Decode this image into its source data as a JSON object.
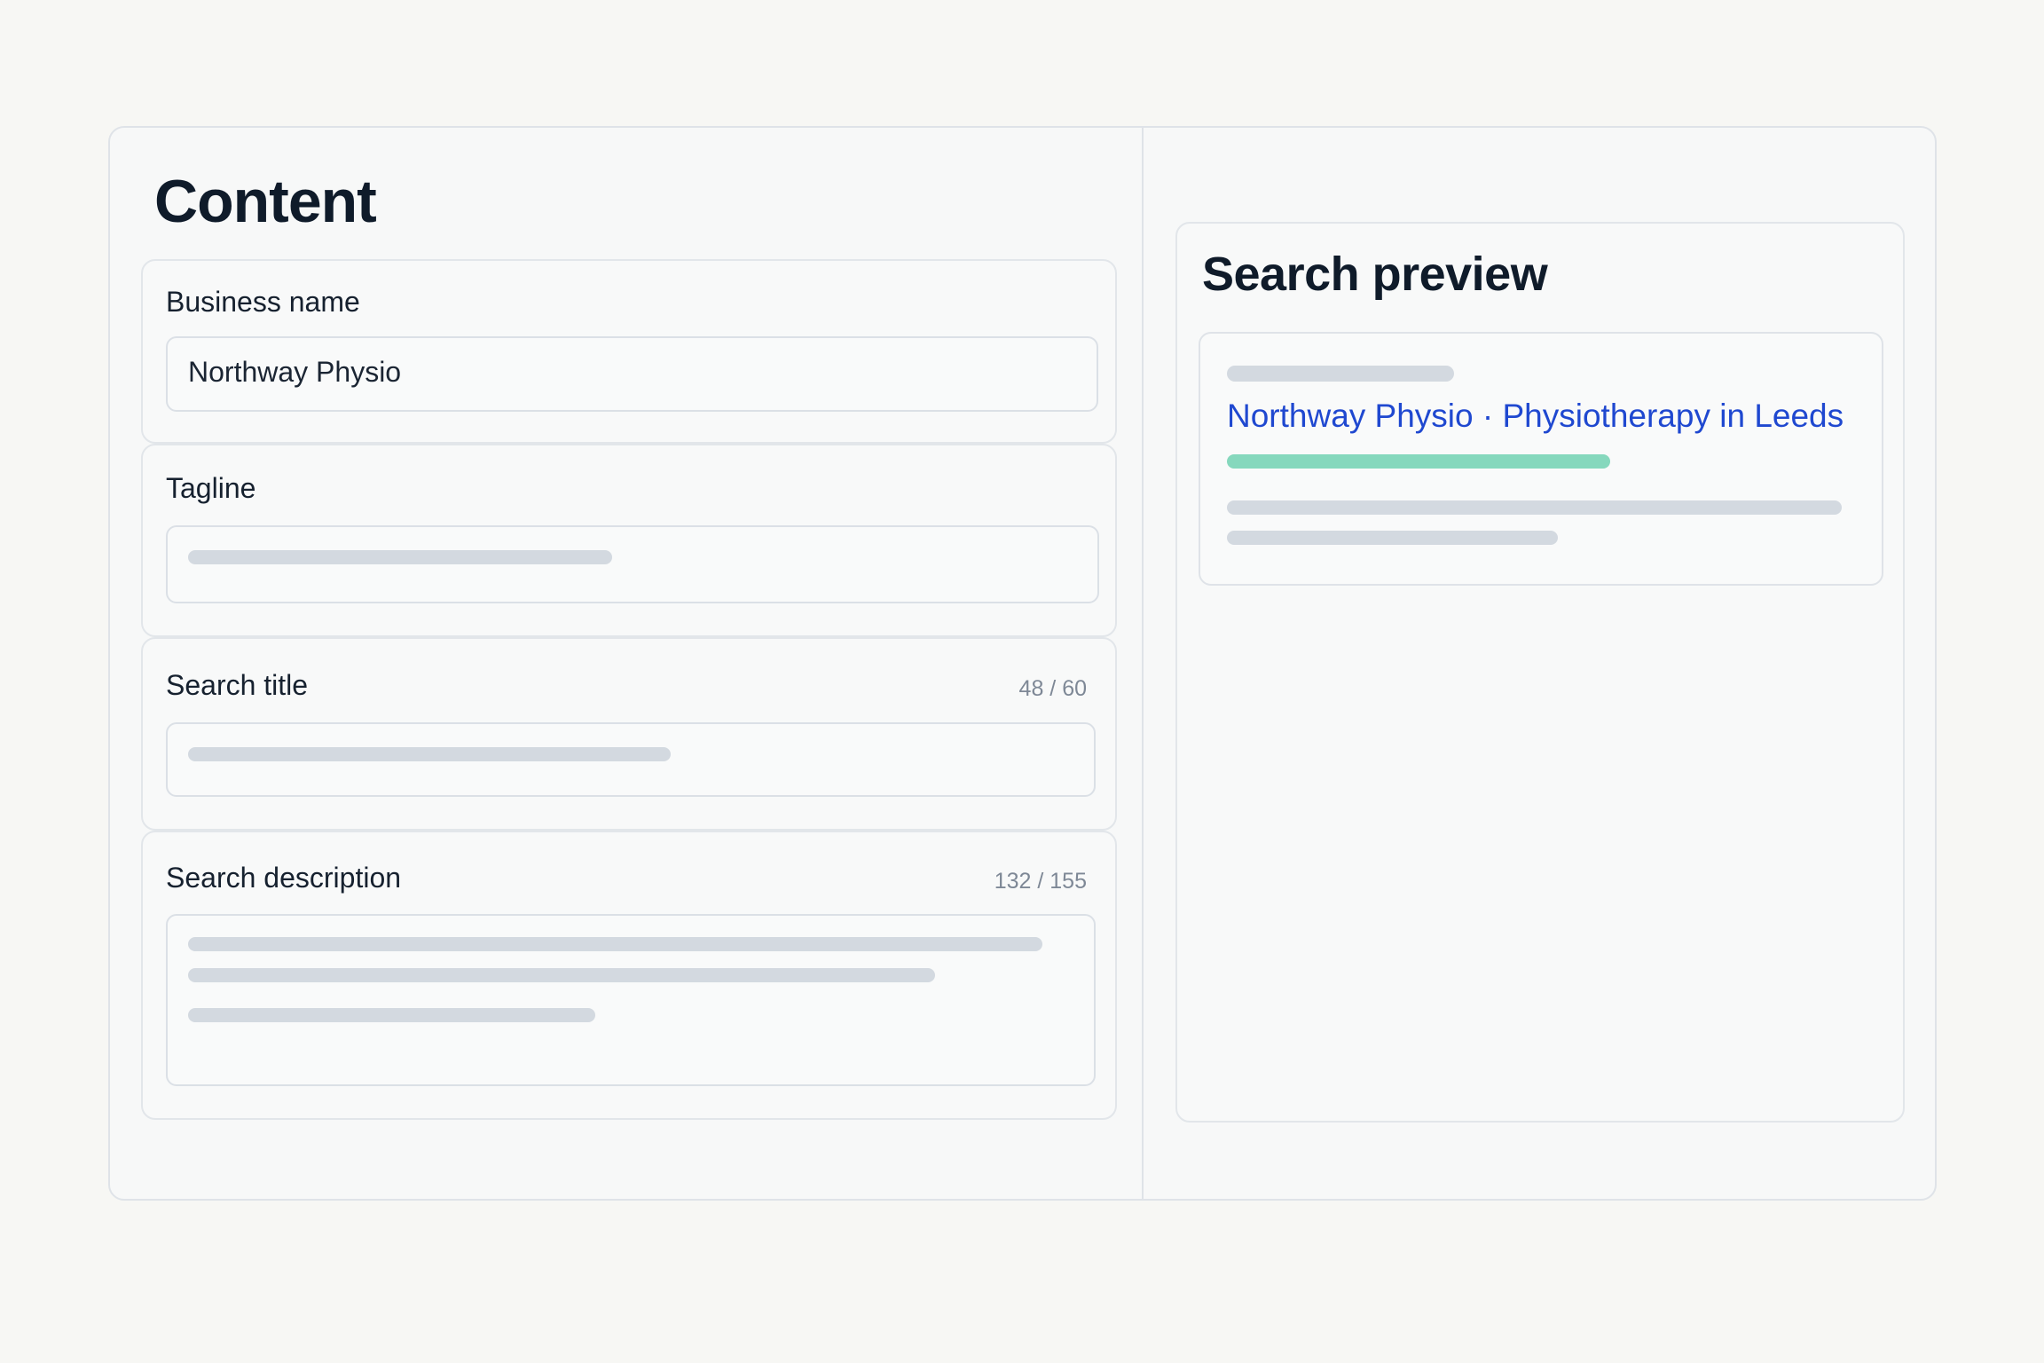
{
  "content": {
    "title": "Content",
    "fields": {
      "business_name": {
        "label": "Business name",
        "value": "Northway Physio"
      },
      "tagline": {
        "label": "Tagline"
      },
      "search_title": {
        "label": "Search title",
        "count": "48 / 60"
      },
      "search_description": {
        "label": "Search description",
        "count": "132 / 155"
      }
    }
  },
  "preview": {
    "title": "Search preview",
    "result_title": "Northway Physio · Physiotherapy in Leeds"
  },
  "colors": {
    "link": "#1f48d0",
    "url_bar": "#86d8bd",
    "placeholder_bar": "#d3d9e0"
  }
}
